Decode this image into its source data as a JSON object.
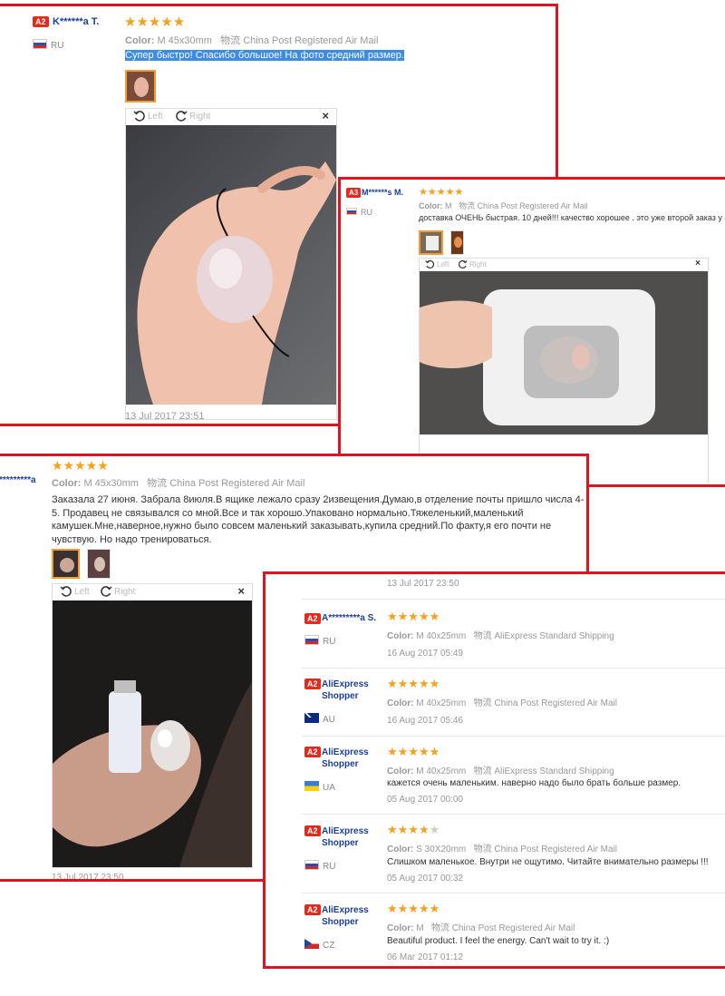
{
  "colors": {
    "frame": "#e0141e",
    "star": "#f7a01c",
    "level": "#e42a1c",
    "name": "#1a3f9a",
    "highlight": "#3a8ce6"
  },
  "icons": {
    "rotate_left": "rotate-left-icon",
    "rotate_right": "rotate-right-icon",
    "close": "close-icon",
    "star": "star-icon"
  },
  "labels": {
    "color": "Color:",
    "rotate_left": "Left",
    "rotate_right": "Right",
    "close": "×",
    "shipping_prefix": "物流"
  },
  "panel1": {
    "level": "A2",
    "name": "K******a T.",
    "country": "RU",
    "stars": "★★★★★",
    "color_value": "M 45x30mm",
    "shipping": "China Post Registered Air Mail",
    "text": "Супер быстро! Спасибо большое! На фото средний размер.",
    "date": "13 Jul 2017 23:51"
  },
  "panel2": {
    "level": "A3",
    "name": "M******s M.",
    "country": "RU",
    "stars": "★★★★★",
    "color_value": "M",
    "shipping": "China Post Registered Air Mail",
    "text": "доставка ОЧЕНЬ быстрая. 10 дней!!! качество хорошее . это уже второй заказ у этого"
  },
  "panel3": {
    "name_partial": "*********a",
    "stars": "★★★★★",
    "color_value": "M 45x30mm",
    "shipping": "China Post Registered Air Mail",
    "text": "Заказала 27 июня. Забрала 8июля.В ящике лежало сразу 2извещения.Думаю,в отделение почты пришло числа 4-5. Продавец не связывался со мной.Все и так хорошо.Упаковано нормально.Тяжеленький,маленький камушек.Мне,наверное,нужно было совсем маленький заказывать,купила средний.По факту,я его почти не чувствую. Но надо тренироваться.",
    "date": "13 Jul 2017 23:50"
  },
  "panel4": {
    "top_date": "13 Jul 2017 23:50",
    "reviews": [
      {
        "level": "A2",
        "name": "A*********a S.",
        "country": "RU",
        "flag": "ru",
        "stars": "★★★★★",
        "stars_off": "",
        "color_value": "M 40x25mm",
        "shipping": "AliExpress Standard Shipping",
        "text": "",
        "date": "16 Aug 2017 05:49"
      },
      {
        "level": "A2",
        "name": "AliExpress Shopper",
        "country": "AU",
        "flag": "au",
        "stars": "★★★★★",
        "stars_off": "",
        "color_value": "M 40x25mm",
        "shipping": "China Post Registered Air Mail",
        "text": "",
        "date": "16 Aug 2017 05:46"
      },
      {
        "level": "A2",
        "name": "AliExpress Shopper",
        "country": "UA",
        "flag": "ua",
        "stars": "★★★★★",
        "stars_off": "",
        "color_value": "M 40x25mm",
        "shipping": "AliExpress Standard Shipping",
        "text": "кажется очень маленьким. наверно надо было брать больше размер.",
        "date": "05 Aug 2017 00:00"
      },
      {
        "level": "A2",
        "name": "AliExpress Shopper",
        "country": "RU",
        "flag": "ru",
        "stars": "★★★★",
        "stars_off": "★",
        "color_value": "S 30X20mm",
        "shipping": "China Post Registered Air Mail",
        "text": "Слишком маленькое. Внутри не ощутимо. Читайте внимательно размеры !!!",
        "date": "05 Aug 2017 00:32"
      },
      {
        "level": "A2",
        "name": "AliExpress Shopper",
        "country": "CZ",
        "flag": "cz",
        "stars": "★★★★★",
        "stars_off": "",
        "color_value": "M",
        "shipping": "China Post Registered Air Mail",
        "text": "Beautiful product. I feel the energy. Can't wait to try it. :)",
        "date": "06 Mar 2017 01:12"
      }
    ]
  }
}
